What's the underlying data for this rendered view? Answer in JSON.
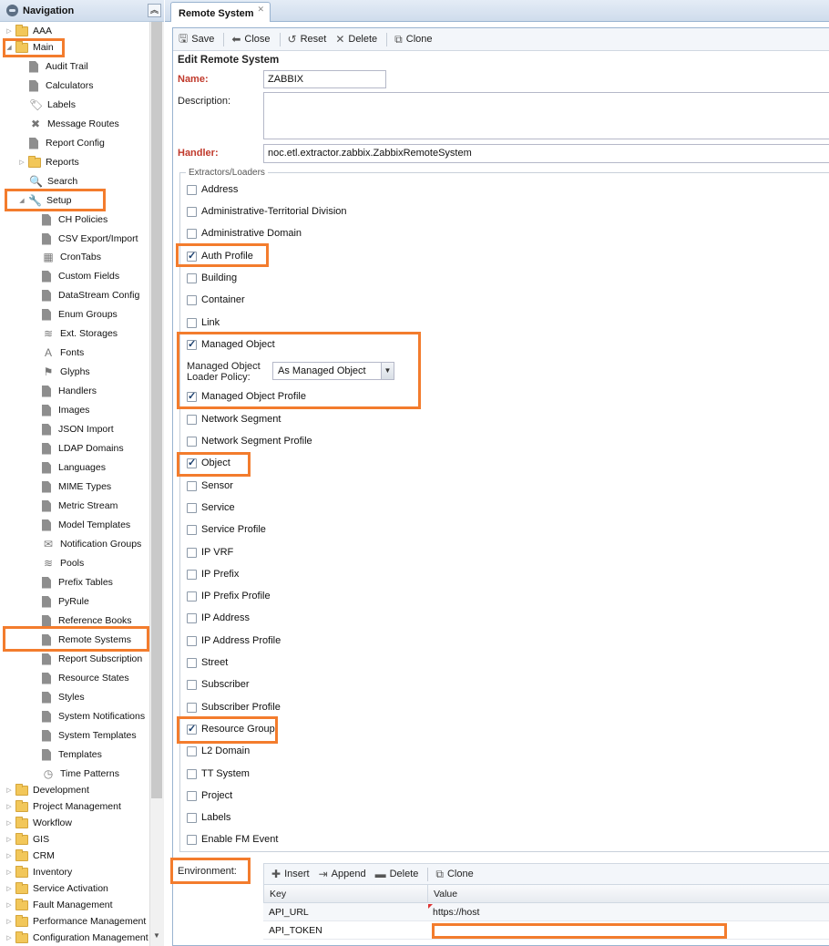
{
  "navigation": {
    "title": "Navigation",
    "items": [
      {
        "label": "AAA",
        "kind": "folder",
        "expander": "▷"
      },
      {
        "label": "Main",
        "kind": "folder",
        "expander": "◢"
      },
      {
        "label": "Audit Trail",
        "icon": "doc-icon"
      },
      {
        "label": "Calculators",
        "icon": "doc-icon"
      },
      {
        "label": "Labels",
        "icon": "tag-icon"
      },
      {
        "label": "Message Routes",
        "icon": "routes-icon"
      },
      {
        "label": "Report Config",
        "icon": "doc-icon"
      },
      {
        "label": "Reports",
        "kind": "folder",
        "expander": "▷"
      },
      {
        "label": "Search",
        "icon": "search-icon"
      },
      {
        "label": "Setup",
        "icon": "wrench-icon",
        "expander": "◢"
      },
      {
        "label": "CH Policies",
        "icon": "doc-icon"
      },
      {
        "label": "CSV Export/Import",
        "icon": "doc-icon"
      },
      {
        "label": "CronTabs",
        "icon": "calendar-icon"
      },
      {
        "label": "Custom Fields",
        "icon": "doc-icon"
      },
      {
        "label": "DataStream Config",
        "icon": "doc-icon"
      },
      {
        "label": "Enum Groups",
        "icon": "doc-icon"
      },
      {
        "label": "Ext. Storages",
        "icon": "database-icon"
      },
      {
        "label": "Fonts",
        "icon": "font-icon"
      },
      {
        "label": "Glyphs",
        "icon": "flag-icon"
      },
      {
        "label": "Handlers",
        "icon": "doc-icon"
      },
      {
        "label": "Images",
        "icon": "doc-icon"
      },
      {
        "label": "JSON Import",
        "icon": "doc-icon"
      },
      {
        "label": "LDAP Domains",
        "icon": "doc-icon"
      },
      {
        "label": "Languages",
        "icon": "doc-icon"
      },
      {
        "label": "MIME Types",
        "icon": "doc-icon"
      },
      {
        "label": "Metric Stream",
        "icon": "doc-icon"
      },
      {
        "label": "Model Templates",
        "icon": "doc-icon"
      },
      {
        "label": "Notification Groups",
        "icon": "envelope-icon"
      },
      {
        "label": "Pools",
        "icon": "database-icon"
      },
      {
        "label": "Prefix Tables",
        "icon": "doc-icon"
      },
      {
        "label": "PyRule",
        "icon": "doc-icon"
      },
      {
        "label": "Reference Books",
        "icon": "doc-icon"
      },
      {
        "label": "Remote Systems",
        "icon": "doc-icon"
      },
      {
        "label": "Report Subscription",
        "icon": "doc-icon"
      },
      {
        "label": "Resource States",
        "icon": "doc-icon"
      },
      {
        "label": "Styles",
        "icon": "doc-icon"
      },
      {
        "label": "System Notifications",
        "icon": "doc-icon"
      },
      {
        "label": "System Templates",
        "icon": "doc-icon"
      },
      {
        "label": "Templates",
        "icon": "doc-icon"
      },
      {
        "label": "Time Patterns",
        "icon": "clock-icon"
      },
      {
        "label": "Development",
        "kind": "folder",
        "expander": "▷"
      },
      {
        "label": "Project Management",
        "kind": "folder",
        "expander": "▷"
      },
      {
        "label": "Workflow",
        "kind": "folder",
        "expander": "▷"
      },
      {
        "label": "GIS",
        "kind": "folder",
        "expander": "▷"
      },
      {
        "label": "CRM",
        "kind": "folder",
        "expander": "▷"
      },
      {
        "label": "Inventory",
        "kind": "folder",
        "expander": "▷"
      },
      {
        "label": "Service Activation",
        "kind": "folder",
        "expander": "▷"
      },
      {
        "label": "Fault Management",
        "kind": "folder",
        "expander": "▷"
      },
      {
        "label": "Performance Management",
        "kind": "folder",
        "expander": "▷"
      },
      {
        "label": "Configuration Management",
        "kind": "folder",
        "expander": "▷"
      }
    ]
  },
  "tab": {
    "label": "Remote System",
    "close": "✕"
  },
  "toolbar": {
    "save": "Save",
    "close": "Close",
    "reset": "Reset",
    "delete": "Delete",
    "clone": "Clone"
  },
  "form": {
    "title": "Edit Remote System",
    "name_label": "Name:",
    "name_value": "ZABBIX",
    "description_label": "Description:",
    "description_value": "",
    "handler_label": "Handler:",
    "handler_value": "noc.etl.extractor.zabbix.ZabbixRemoteSystem",
    "legend": "Extractors/Loaders",
    "checkboxes": [
      {
        "label": "Address",
        "checked": false
      },
      {
        "label": "Administrative-Territorial Division",
        "checked": false
      },
      {
        "label": "Administrative Domain",
        "checked": false
      },
      {
        "label": "Auth Profile",
        "checked": true
      },
      {
        "label": "Building",
        "checked": false
      },
      {
        "label": "Container",
        "checked": false
      },
      {
        "label": "Link",
        "checked": false
      },
      {
        "label": "Managed Object",
        "checked": true
      },
      {
        "label": "Managed Object Profile",
        "checked": true
      },
      {
        "label": "Network Segment",
        "checked": false
      },
      {
        "label": "Network Segment Profile",
        "checked": false
      },
      {
        "label": "Object",
        "checked": true
      },
      {
        "label": "Sensor",
        "checked": false
      },
      {
        "label": "Service",
        "checked": false
      },
      {
        "label": "Service Profile",
        "checked": false
      },
      {
        "label": "IP VRF",
        "checked": false
      },
      {
        "label": "IP Prefix",
        "checked": false
      },
      {
        "label": "IP Prefix Profile",
        "checked": false
      },
      {
        "label": "IP Address",
        "checked": false
      },
      {
        "label": "IP Address Profile",
        "checked": false
      },
      {
        "label": "Street",
        "checked": false
      },
      {
        "label": "Subscriber",
        "checked": false
      },
      {
        "label": "Subscriber Profile",
        "checked": false
      },
      {
        "label": "Resource Group",
        "checked": true
      },
      {
        "label": "L2 Domain",
        "checked": false
      },
      {
        "label": "TT System",
        "checked": false
      },
      {
        "label": "Project",
        "checked": false
      },
      {
        "label": "Labels",
        "checked": false
      },
      {
        "label": "Enable FM Event",
        "checked": false
      }
    ],
    "mo_policy_label_1": "Managed Object",
    "mo_policy_label_2": "Loader Policy:",
    "mo_policy_value": "As Managed Object",
    "environment_label": "Environment:"
  },
  "grid": {
    "toolbar": {
      "insert": "Insert",
      "append": "Append",
      "delete": "Delete",
      "clone": "Clone"
    },
    "columns": [
      "Key",
      "Value"
    ],
    "rows": [
      {
        "key": "API_URL",
        "value": "https://host"
      },
      {
        "key": "API_TOKEN",
        "value": ""
      }
    ]
  },
  "colors": {
    "highlight": "#f37c2d",
    "required_label": "#c0392b"
  }
}
